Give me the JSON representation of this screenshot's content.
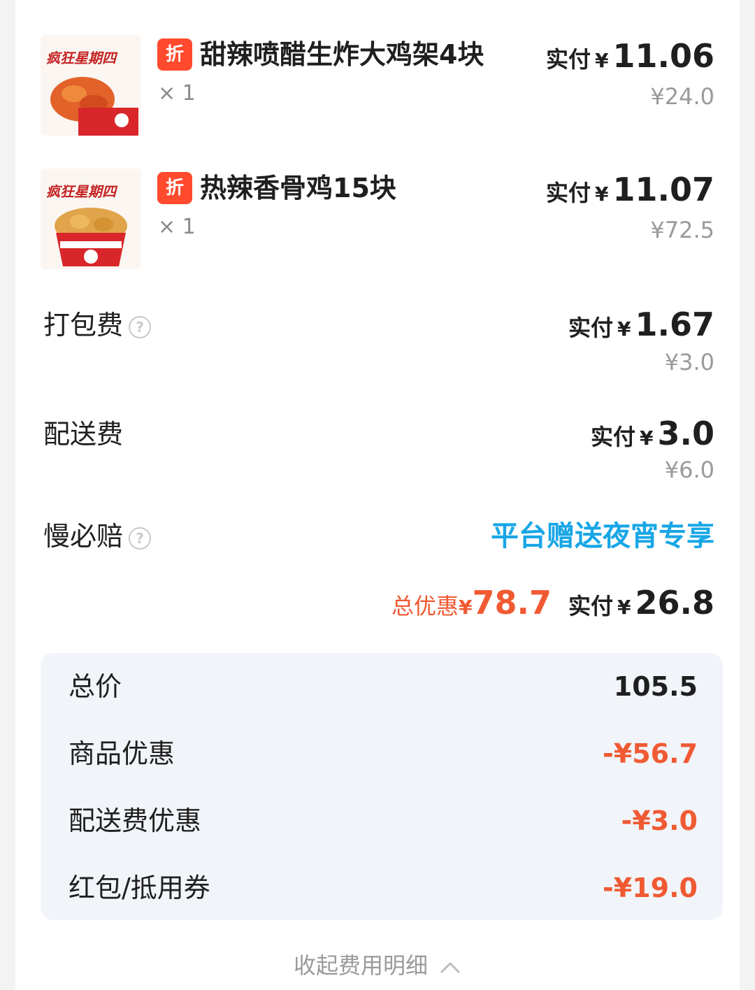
{
  "items": [
    {
      "badge": "折",
      "name": "甜辣喷醋生炸大鸡架4块",
      "qty": "× 1",
      "pay_label": "实付",
      "pay_yen": "¥",
      "pay_amount": "11.06",
      "original": "¥24.0",
      "image_text": "疯狂星期四"
    },
    {
      "badge": "折",
      "name": "热辣香骨鸡15块",
      "qty": "× 1",
      "pay_label": "实付",
      "pay_yen": "¥",
      "pay_amount": "11.07",
      "original": "¥72.5",
      "image_text": "疯狂星期四"
    }
  ],
  "fees": {
    "packing": {
      "label": "打包费",
      "pay_label": "实付",
      "pay_yen": "¥",
      "pay_amount": "1.67",
      "original": "¥3.0"
    },
    "delivery": {
      "label": "配送费",
      "pay_label": "实付",
      "pay_yen": "¥",
      "pay_amount": "3.0",
      "original": "¥6.0"
    },
    "slow_comp": {
      "label": "慢必赔",
      "promo": "平台赠送夜宵专享"
    }
  },
  "summary": {
    "discount_label": "总优惠",
    "discount_yen": "¥",
    "discount_amount": "78.7",
    "pay_label": "实付",
    "pay_yen": "¥",
    "pay_amount": "26.8"
  },
  "breakdown": [
    {
      "label": "总价",
      "value": "105.5"
    },
    {
      "label": "商品优惠",
      "value": "-¥56.7"
    },
    {
      "label": "配送费优惠",
      "value": "-¥3.0"
    },
    {
      "label": "红包/抵用券",
      "value": "-¥19.0"
    }
  ],
  "collapse_label": "收起费用明细",
  "colors": {
    "badge": "#ff4a2e",
    "discount": "#f05a33",
    "promo": "#17a6e6",
    "panel_bg": "#f1f4f8"
  },
  "icons": {
    "help": "question-circle-icon",
    "collapse": "chevron-up-icon"
  }
}
